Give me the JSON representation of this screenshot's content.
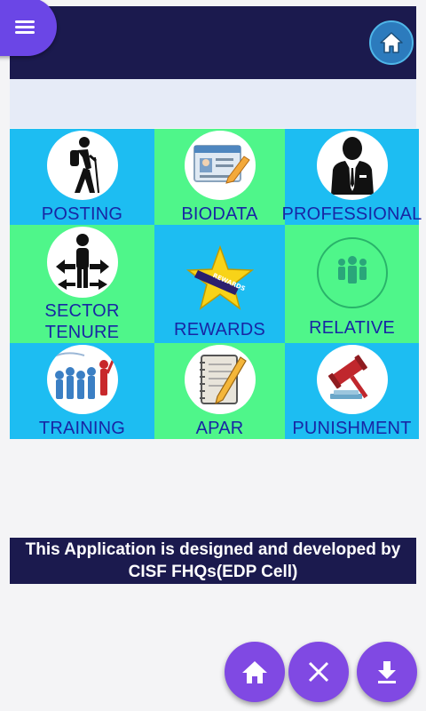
{
  "header": {
    "menu_icon": "hamburger-menu-icon",
    "home_icon": "home-icon"
  },
  "tiles": [
    {
      "label": "POSTING",
      "icon": "hiker-icon",
      "color": "#1dbdf2"
    },
    {
      "label": "BIODATA",
      "icon": "profile-card-icon",
      "color": "#4ff68a"
    },
    {
      "label": "PROFESSIONAL",
      "icon": "businessman-icon",
      "color": "#1dbdf2"
    },
    {
      "label_line1": "SECTOR",
      "label_line2": "TENURE",
      "icon": "crossroads-person-icon",
      "color": "#4ff68a"
    },
    {
      "label": "REWARDS",
      "icon": "star-rewards-icon",
      "color": "#1dbdf2",
      "badge": "REWARDS"
    },
    {
      "label": "RELATIVE",
      "icon": "group-icon",
      "color": "#4ff68a"
    },
    {
      "label": "TRAINING",
      "icon": "team-training-icon",
      "color": "#1dbdf2"
    },
    {
      "label": "APAR",
      "icon": "notebook-pencil-icon",
      "color": "#4ff68a"
    },
    {
      "label": "PUNISHMENT",
      "icon": "gavel-icon",
      "color": "#1dbdf2"
    }
  ],
  "footer": {
    "line1": "This Application is designed and developed by",
    "line2": "CISF FHQs(EDP Cell)"
  },
  "fabs": [
    "home-icon",
    "close-icon",
    "download-icon"
  ],
  "colors": {
    "header": "#1b1a4e",
    "accent": "#8049e3",
    "label": "#1826a4"
  }
}
